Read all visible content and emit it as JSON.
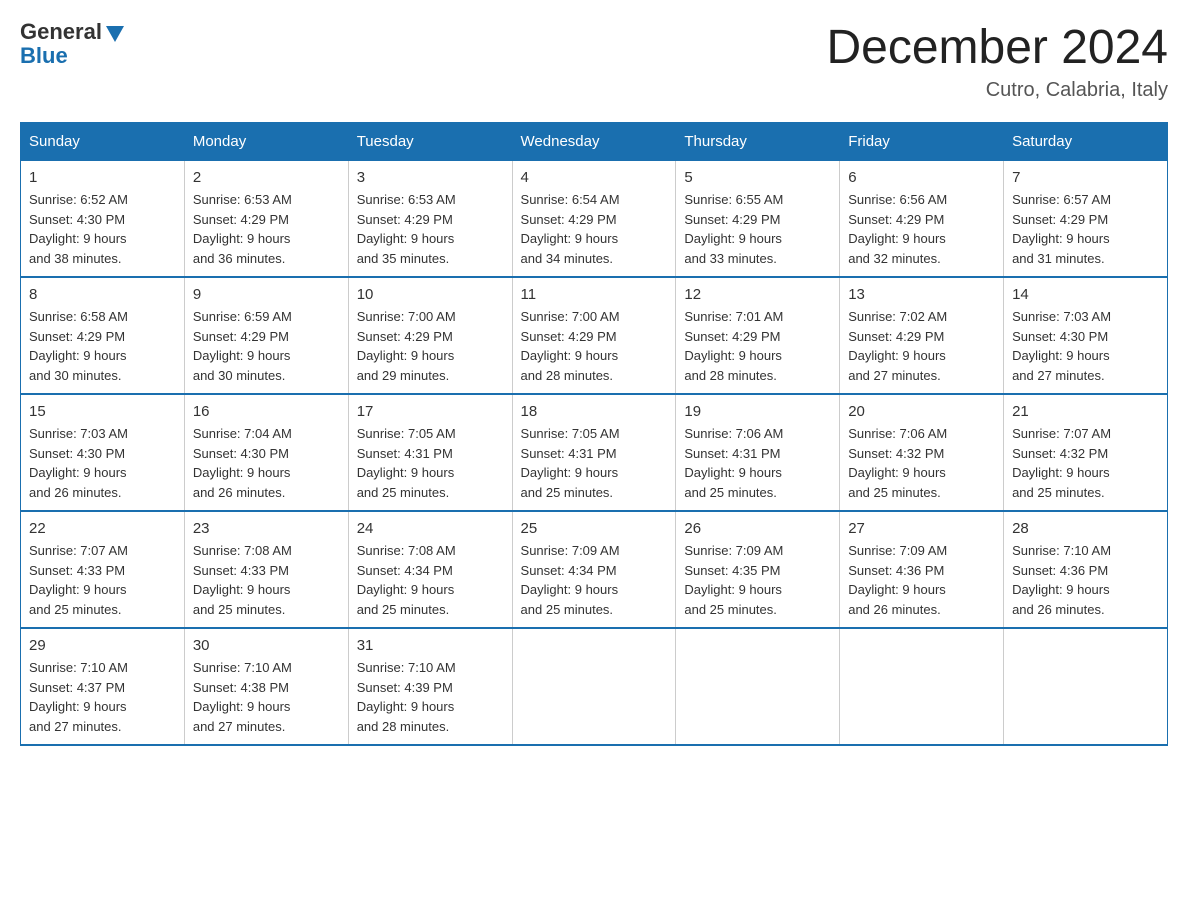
{
  "header": {
    "logo_general": "General",
    "logo_blue": "Blue",
    "month_title": "December 2024",
    "location": "Cutro, Calabria, Italy"
  },
  "weekdays": [
    "Sunday",
    "Monday",
    "Tuesday",
    "Wednesday",
    "Thursday",
    "Friday",
    "Saturday"
  ],
  "weeks": [
    [
      {
        "day": "1",
        "sunrise": "6:52 AM",
        "sunset": "4:30 PM",
        "daylight": "9 hours and 38 minutes."
      },
      {
        "day": "2",
        "sunrise": "6:53 AM",
        "sunset": "4:29 PM",
        "daylight": "9 hours and 36 minutes."
      },
      {
        "day": "3",
        "sunrise": "6:53 AM",
        "sunset": "4:29 PM",
        "daylight": "9 hours and 35 minutes."
      },
      {
        "day": "4",
        "sunrise": "6:54 AM",
        "sunset": "4:29 PM",
        "daylight": "9 hours and 34 minutes."
      },
      {
        "day": "5",
        "sunrise": "6:55 AM",
        "sunset": "4:29 PM",
        "daylight": "9 hours and 33 minutes."
      },
      {
        "day": "6",
        "sunrise": "6:56 AM",
        "sunset": "4:29 PM",
        "daylight": "9 hours and 32 minutes."
      },
      {
        "day": "7",
        "sunrise": "6:57 AM",
        "sunset": "4:29 PM",
        "daylight": "9 hours and 31 minutes."
      }
    ],
    [
      {
        "day": "8",
        "sunrise": "6:58 AM",
        "sunset": "4:29 PM",
        "daylight": "9 hours and 30 minutes."
      },
      {
        "day": "9",
        "sunrise": "6:59 AM",
        "sunset": "4:29 PM",
        "daylight": "9 hours and 30 minutes."
      },
      {
        "day": "10",
        "sunrise": "7:00 AM",
        "sunset": "4:29 PM",
        "daylight": "9 hours and 29 minutes."
      },
      {
        "day": "11",
        "sunrise": "7:00 AM",
        "sunset": "4:29 PM",
        "daylight": "9 hours and 28 minutes."
      },
      {
        "day": "12",
        "sunrise": "7:01 AM",
        "sunset": "4:29 PM",
        "daylight": "9 hours and 28 minutes."
      },
      {
        "day": "13",
        "sunrise": "7:02 AM",
        "sunset": "4:29 PM",
        "daylight": "9 hours and 27 minutes."
      },
      {
        "day": "14",
        "sunrise": "7:03 AM",
        "sunset": "4:30 PM",
        "daylight": "9 hours and 27 minutes."
      }
    ],
    [
      {
        "day": "15",
        "sunrise": "7:03 AM",
        "sunset": "4:30 PM",
        "daylight": "9 hours and 26 minutes."
      },
      {
        "day": "16",
        "sunrise": "7:04 AM",
        "sunset": "4:30 PM",
        "daylight": "9 hours and 26 minutes."
      },
      {
        "day": "17",
        "sunrise": "7:05 AM",
        "sunset": "4:31 PM",
        "daylight": "9 hours and 25 minutes."
      },
      {
        "day": "18",
        "sunrise": "7:05 AM",
        "sunset": "4:31 PM",
        "daylight": "9 hours and 25 minutes."
      },
      {
        "day": "19",
        "sunrise": "7:06 AM",
        "sunset": "4:31 PM",
        "daylight": "9 hours and 25 minutes."
      },
      {
        "day": "20",
        "sunrise": "7:06 AM",
        "sunset": "4:32 PM",
        "daylight": "9 hours and 25 minutes."
      },
      {
        "day": "21",
        "sunrise": "7:07 AM",
        "sunset": "4:32 PM",
        "daylight": "9 hours and 25 minutes."
      }
    ],
    [
      {
        "day": "22",
        "sunrise": "7:07 AM",
        "sunset": "4:33 PM",
        "daylight": "9 hours and 25 minutes."
      },
      {
        "day": "23",
        "sunrise": "7:08 AM",
        "sunset": "4:33 PM",
        "daylight": "9 hours and 25 minutes."
      },
      {
        "day": "24",
        "sunrise": "7:08 AM",
        "sunset": "4:34 PM",
        "daylight": "9 hours and 25 minutes."
      },
      {
        "day": "25",
        "sunrise": "7:09 AM",
        "sunset": "4:34 PM",
        "daylight": "9 hours and 25 minutes."
      },
      {
        "day": "26",
        "sunrise": "7:09 AM",
        "sunset": "4:35 PM",
        "daylight": "9 hours and 25 minutes."
      },
      {
        "day": "27",
        "sunrise": "7:09 AM",
        "sunset": "4:36 PM",
        "daylight": "9 hours and 26 minutes."
      },
      {
        "day": "28",
        "sunrise": "7:10 AM",
        "sunset": "4:36 PM",
        "daylight": "9 hours and 26 minutes."
      }
    ],
    [
      {
        "day": "29",
        "sunrise": "7:10 AM",
        "sunset": "4:37 PM",
        "daylight": "9 hours and 27 minutes."
      },
      {
        "day": "30",
        "sunrise": "7:10 AM",
        "sunset": "4:38 PM",
        "daylight": "9 hours and 27 minutes."
      },
      {
        "day": "31",
        "sunrise": "7:10 AM",
        "sunset": "4:39 PM",
        "daylight": "9 hours and 28 minutes."
      },
      null,
      null,
      null,
      null
    ]
  ],
  "labels": {
    "sunrise": "Sunrise:",
    "sunset": "Sunset:",
    "daylight": "Daylight:"
  }
}
